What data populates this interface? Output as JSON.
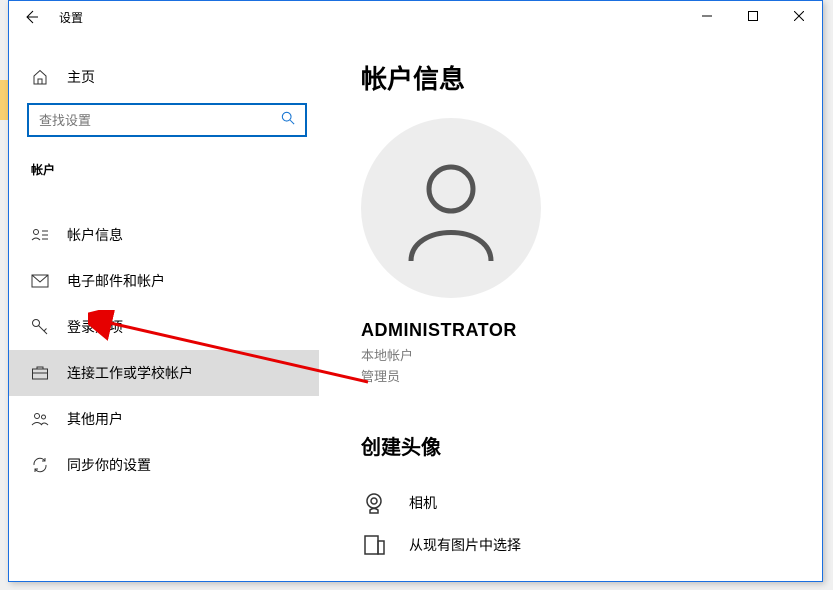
{
  "titlebar": {
    "app_title": "设置"
  },
  "sidebar": {
    "home_label": "主页",
    "search_placeholder": "查找设置",
    "category_label": "帐户",
    "items": [
      {
        "label": "帐户信息"
      },
      {
        "label": "电子邮件和帐户"
      },
      {
        "label": "登录选项"
      },
      {
        "label": "连接工作或学校帐户"
      },
      {
        "label": "其他用户"
      },
      {
        "label": "同步你的设置"
      }
    ]
  },
  "main": {
    "page_title": "帐户信息",
    "username": "ADMINISTRATOR",
    "account_type": "本地帐户",
    "account_role": "管理员",
    "create_avatar_title": "创建头像",
    "options": [
      {
        "label": "相机"
      },
      {
        "label": "从现有图片中选择"
      }
    ]
  }
}
